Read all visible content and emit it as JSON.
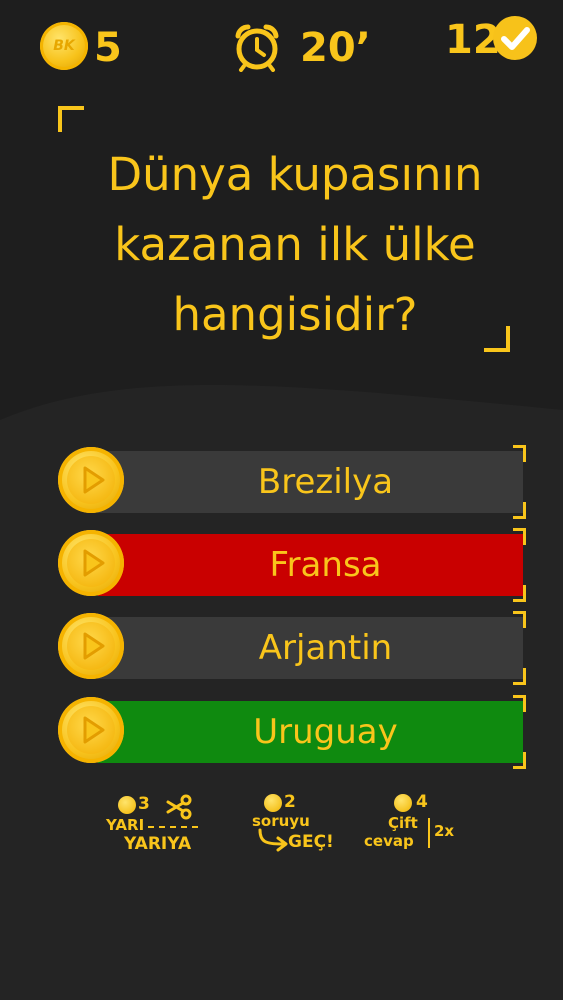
{
  "hud": {
    "coins": "5",
    "coin_label": "BK",
    "timer": "20’",
    "correct_count": "12"
  },
  "question": {
    "lines": [
      "Dünya kupasının",
      "kazanan ilk ülke",
      "hangisidir?"
    ]
  },
  "answers": [
    {
      "label": "Brezilya",
      "state": "neutral"
    },
    {
      "label": "Fransa",
      "state": "wrong"
    },
    {
      "label": "Arjantin",
      "state": "neutral"
    },
    {
      "label": "Uruguay",
      "state": "correct"
    }
  ],
  "jokers": {
    "half": {
      "cost": "3",
      "line1": "YARI",
      "line2": "YARIYA",
      "icon": "scissors-icon"
    },
    "skip": {
      "cost": "2",
      "line1": "soruyu",
      "line2": "GEÇ!",
      "icon": "arrow-icon"
    },
    "double": {
      "cost": "4",
      "line1": "Çift",
      "line2": "cevap",
      "badge": "2x"
    }
  },
  "colors": {
    "accent": "#f9c51b",
    "background": "#1e1e1e",
    "neutral_bar": "#3a3a3a",
    "wrong_bar": "#c90000",
    "correct_bar": "#0f8a0f"
  }
}
